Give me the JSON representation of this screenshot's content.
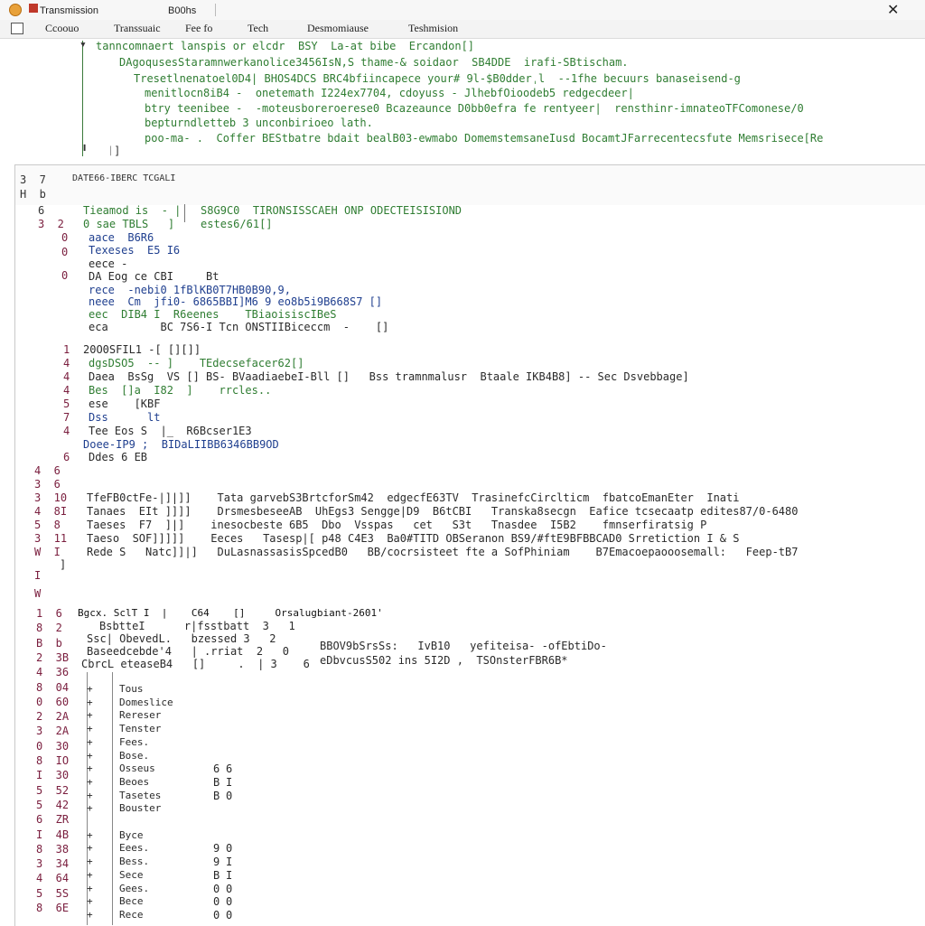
{
  "window": {
    "tabs": [
      {
        "label": "Transmission"
      },
      {
        "label": "B00hs"
      }
    ]
  },
  "menubar": {
    "items": [
      "Ccoouo",
      "Transsuaic",
      "Fee fo",
      "Tech",
      "Desmomiause",
      "Teshmision"
    ]
  },
  "log": {
    "lines": [
      "tanncomnaert lanspis or elcdr  BSY  La-at bibe  Ercandon[]",
      "DAgoqusesStaramnwerkanolice3456IsN,S thame-& soidaor  SB4DDE  irafi-SBtischam.",
      "Tresetlnenatoel0D4| BHOS4DCS BRC4bfiincapece your# 9l-$B0dderˌl  --1fhe becuurs banaseisend-g",
      "menitlocn8iB4 -  onetemath I224ex7704, cdoyuss - JlhebfOioodeb5 redgecdeer|",
      "btry teenibee -  -moteusboreroerese0 Bcazeaunce D0bb0efra fe rentyeer|  rensthinr-imnateoTFComonese/0",
      "bepturndletteb 3 unconbirioeo lath.",
      "poo-ma- .  Coffer BEStbatre bdait bealB03-ewmabo DomemstemsaneIusd BocamtJFarrecentecsfute Memsrisece[Re"
    ]
  },
  "editor": {
    "title": "DATE66-IBERC TCGALI",
    "gutter_top": [
      "3  7",
      "H  b",
      "6",
      "3  2",
      "0",
      "0",
      "0"
    ],
    "block1": {
      "line0": "Tieamod is  - |   S8G9C0  TIRONSISSCAEH ONP ODECTEISISIOND",
      "line1": "0 sae TBLS   ]    estes6/61[]",
      "line2": "aace  B6R6",
      "line3": "Texeses  E5 I6",
      "line4": "eece -",
      "line5": "DA Eog ce CBI     Bt",
      "line6": "rece  -nebi0 1fBlKB0T7HB0B90,9,",
      "line7": "neee  Cm  jfi0- 6865BBI]M6 9 eo8b5i9B668S7 []",
      "line8": "eec  DIB4 I  R6eenes    TBiaoisiscIBeS",
      "line9": "eca        BC 7S6-I Tcn ONSTIIBiceccm  -    []"
    },
    "block2": {
      "gutter": [
        "1",
        "4",
        "4",
        "4",
        "5",
        "7",
        "4",
        "6"
      ],
      "line0": "20O0SFIL1 -[ [][]]",
      "line1": "dgsDSO5  -- ]    TEdecsefacer62[]",
      "line2": "Daea  BsSg  VS [] BS- BVaadiaebeI-Bll []   Bss tramnmalusr  Btaale IKB4B8] -- Sec Dsvebbage]",
      "line3": "Bes  []a  I82  ]    rrcles..",
      "line4": "ese    [KBF",
      "line5": "Dss      lt",
      "line6": "Tee Eos S  |_  R6Bcser1E3",
      "line7": "Doee-IP9 ;  BIDaLIIBB6346BB9OD",
      "line8": "Ddes 6 EB"
    },
    "block3": {
      "gutter": [
        "4  6",
        "3  6",
        "3  10",
        "4  8I",
        "5  8",
        "3  11",
        "W  I",
        "I",
        "W"
      ],
      "line0": "TfeFB0ctFe-|]|]]    Tata garvebS3BrtcforSm42  edgecfE63TV  TrasinefcCirclticm  fbatcoEmanEter  Inati",
      "line1": "Tanaes  EIt ]]]]    DrsmesbeseeAB  UhEgs3 Sengge|D9  B6tCBI   Transka8secgn  Eafice tcsecaatp edites87/0-6480",
      "line2": "Taeses  F7  ]|]    inesocbeste 6B5  Dbo  Vsspas   cet   S3t   Tnasdee  I5B2    fmnserfiratsig P",
      "line3": "Taeso  SOF]]]]]    Eeces   Tasesp|[ p48 C4E3  Ba0#TITD OBSeranon BS9/#ftE9BFBBCAD0 Srretiction I & S",
      "line4": "Rede S   Natc]]|]   DuLasnassasisSpcedB0   BB/cocrsisteet fte a SofPhiniam    B7Emacoepaooosemall:   Feep-tB7",
      "line5": "]"
    },
    "block4": {
      "gutter": [
        "1  6",
        "8  2",
        "B  b",
        "2  3B",
        "4  36",
        "8  04",
        "0  60",
        "2  2A",
        "3  2A",
        "0  30",
        "8  IO",
        "I  30",
        "5  52",
        "5  42",
        "6  ZR",
        "I  4B",
        "8  38",
        "3  34",
        "4  64",
        "5  5S",
        "8  6E"
      ],
      "head": "Bgcx. SclT I  |    C64    []     Orsalugbiant-2601'",
      "head2": "BsbtteI      r|fsstbatt  3   1",
      "head3": "Ssc| ObevedL.   bzessed 3   2",
      "head4": "Baseedcebde'4   | .rriat  2   0",
      "head5": "CbrcL eteaseB4   []     .  | 3    6",
      "right1": "BBOV9bSrsSs:   IvB10   yefiteisa- -ofEbtiDo-",
      "right2": "eDbvcusS502 ins 5I2D ,  TSOnsterFBR6B*",
      "items": [
        {
          "label": "Tous",
          "v1": "",
          "v2": ""
        },
        {
          "label": "Domeslice",
          "v1": "",
          "v2": ""
        },
        {
          "label": "Rereser",
          "v1": "",
          "v2": ""
        },
        {
          "label": "Tenster",
          "v1": "",
          "v2": ""
        },
        {
          "label": "Fees.",
          "v1": "",
          "v2": ""
        },
        {
          "label": "Bose.",
          "v1": "",
          "v2": ""
        },
        {
          "label": "Osseus",
          "v1": "6",
          "v2": "6"
        },
        {
          "label": "Beoes",
          "v1": "B",
          "v2": "I"
        },
        {
          "label": "Tasetes",
          "v1": "B",
          "v2": "0"
        },
        {
          "label": "Bouster",
          "v1": "",
          "v2": ""
        },
        {
          "label": "",
          "v1": "",
          "v2": ""
        },
        {
          "label": "Byce",
          "v1": "",
          "v2": ""
        },
        {
          "label": "Eees.",
          "v1": "9",
          "v2": "0"
        },
        {
          "label": "Bess.",
          "v1": "9",
          "v2": "I"
        },
        {
          "label": "Sece",
          "v1": "B",
          "v2": "I"
        },
        {
          "label": "Gees.",
          "v1": "0",
          "v2": "0"
        },
        {
          "label": "Bece",
          "v1": "0",
          "v2": "0"
        },
        {
          "label": "Rece",
          "v1": "0",
          "v2": "0"
        }
      ]
    }
  }
}
